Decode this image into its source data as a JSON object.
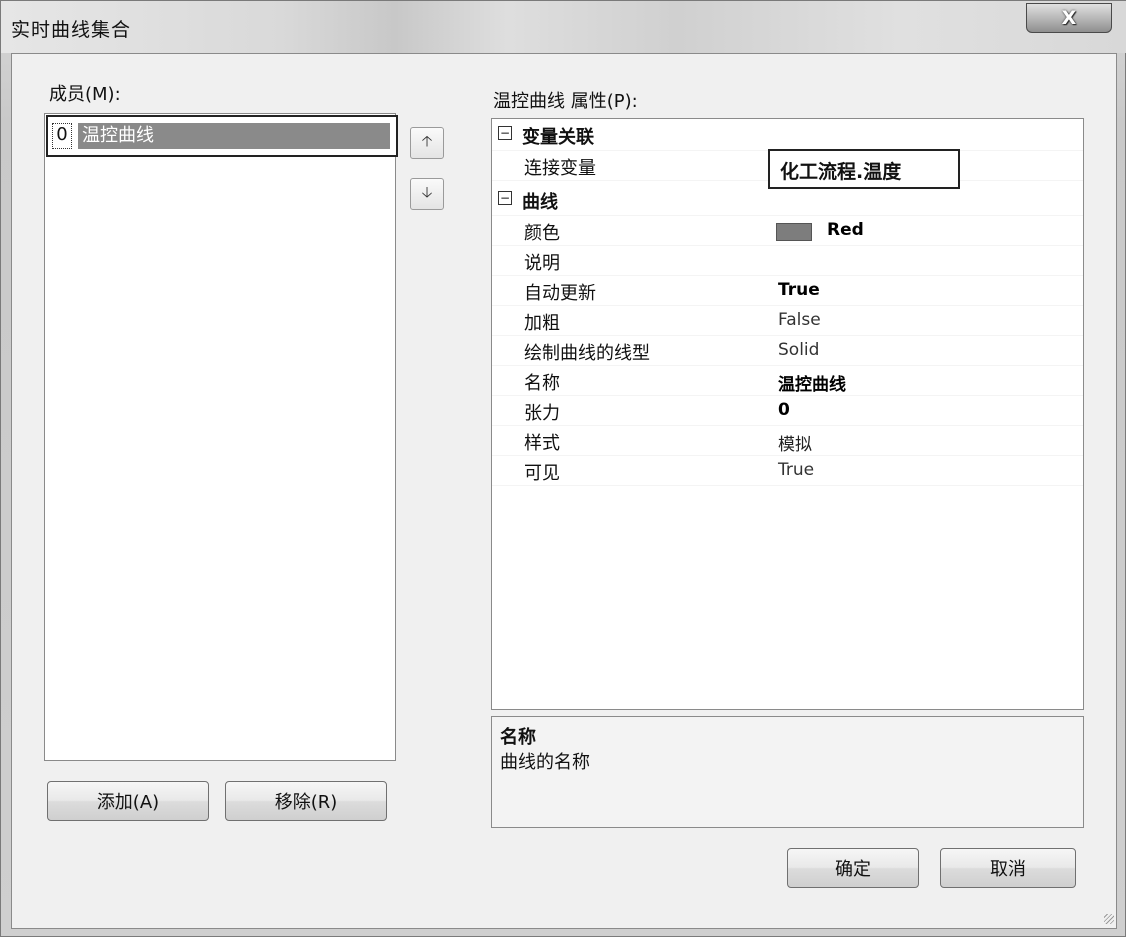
{
  "window": {
    "title": "实时曲线集合",
    "close_label": "X"
  },
  "members": {
    "label": "成员(M):",
    "items": [
      {
        "index": "0",
        "name": "温控曲线"
      }
    ],
    "up_icon": "arrow-up-icon",
    "down_icon": "arrow-down-icon"
  },
  "buttons": {
    "add": "添加(A)",
    "remove": "移除(R)",
    "ok": "确定",
    "cancel": "取消"
  },
  "properties": {
    "label": "温控曲线 属性(P):",
    "categories": [
      {
        "name": "变量关联",
        "toggle": "⊟",
        "rows": [
          {
            "name": "连接变量",
            "value": "化工流程.温度"
          }
        ]
      },
      {
        "name": "曲线",
        "toggle": "⊟",
        "rows": [
          {
            "name": "颜色",
            "value": "Red",
            "swatch_color": "#7d7d7d"
          },
          {
            "name": "说明",
            "value": ""
          },
          {
            "name": "自动更新",
            "value": "True"
          },
          {
            "name": "加粗",
            "value": "False"
          },
          {
            "name": "绘制曲线的线型",
            "value": "Solid"
          },
          {
            "name": "名称",
            "value": "温控曲线"
          },
          {
            "name": "张力",
            "value": "0"
          },
          {
            "name": "样式",
            "value": "模拟"
          },
          {
            "name": "可见",
            "value": "True"
          }
        ]
      }
    ]
  },
  "description": {
    "title": "名称",
    "text": "曲线的名称"
  }
}
